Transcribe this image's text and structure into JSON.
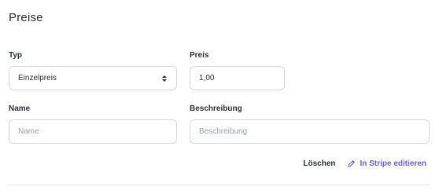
{
  "section": {
    "title": "Preise"
  },
  "fields": {
    "typ": {
      "label": "Typ",
      "value": "Einzelpreis"
    },
    "preis": {
      "label": "Preis",
      "value": "1,00"
    },
    "name": {
      "label": "Name",
      "placeholder": "Name"
    },
    "beschreibung": {
      "label": "Beschreibung",
      "placeholder": "Beschreibung"
    }
  },
  "actions": {
    "delete_label": "Löschen",
    "stripe_label": "In Stripe editieren"
  },
  "colors": {
    "accent": "#6b5cd6",
    "border": "#d4d8de"
  },
  "icons": {
    "select": "chevron-up-down-icon",
    "edit": "pencil-icon"
  }
}
